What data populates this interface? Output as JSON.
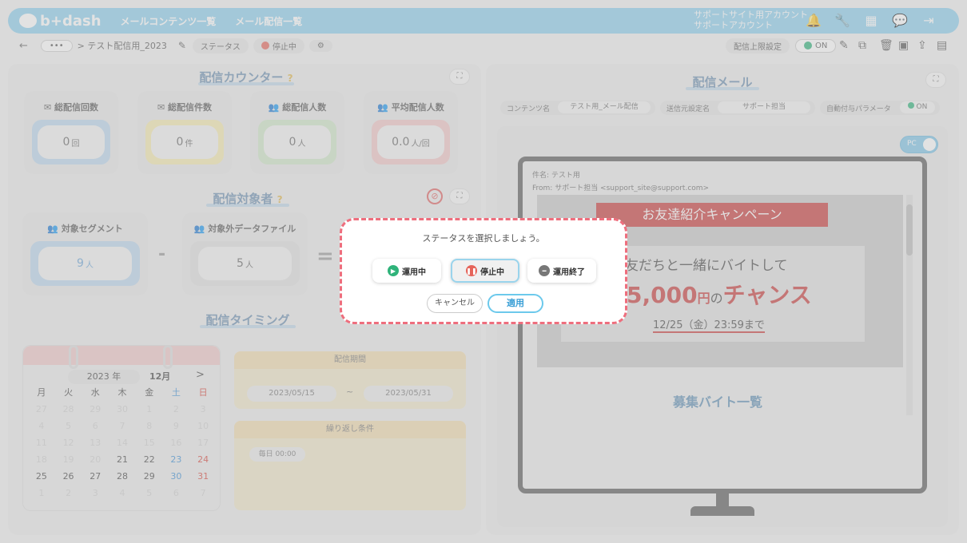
{
  "header": {
    "logo": "b+dash",
    "nav": [
      "メールコンテンツ一覧",
      "メール配信一覧"
    ],
    "account_line1": "サポートサイト用アカウント",
    "account_line2": "サポートアカウント",
    "icons": [
      "bell-icon",
      "wrench-icon",
      "grid-icon",
      "chat-icon",
      "logout-icon"
    ]
  },
  "toolbar": {
    "back": "←",
    "more": "•••",
    "breadcrumb": "> テスト配信用_2023",
    "status_label": "ステータス",
    "status_value": "停止中",
    "limit_label": "配信上限設定",
    "limit_toggle": "ON"
  },
  "counter": {
    "title": "配信カウンター",
    "cards": [
      {
        "label": "総配信回数",
        "value": "0",
        "unit": "回",
        "color": "#bcd7ee"
      },
      {
        "label": "総配信件数",
        "value": "0",
        "unit": "件",
        "color": "#f6ecb0"
      },
      {
        "label": "総配信人数",
        "value": "0",
        "unit": "人",
        "color": "#cfe7c8"
      },
      {
        "label": "平均配信人数",
        "value": "0.0",
        "unit": "人/回",
        "color": "#f3c7c7"
      }
    ]
  },
  "target": {
    "title": "配信対象者",
    "segment_label": "対象セグメント",
    "segment_value": "9",
    "segment_unit": "人",
    "exclude_label": "対象外データファイル",
    "exclude_value": "5",
    "exclude_unit": "人",
    "minus": "-",
    "equals": "="
  },
  "timing": {
    "title": "配信タイミング",
    "calendar": {
      "year": "2023 年",
      "month": "12月",
      "next": ">",
      "weekdays": [
        "月",
        "火",
        "水",
        "木",
        "金",
        "土",
        "日"
      ],
      "rows": [
        [
          "27",
          "28",
          "29",
          "30",
          "1",
          "2",
          "3"
        ],
        [
          "4",
          "5",
          "6",
          "7",
          "8",
          "9",
          "10"
        ],
        [
          "11",
          "12",
          "13",
          "14",
          "15",
          "16",
          "17"
        ],
        [
          "18",
          "19",
          "20",
          "21",
          "22",
          "23",
          "24"
        ],
        [
          "25",
          "26",
          "27",
          "28",
          "29",
          "30",
          "31"
        ],
        [
          "1",
          "2",
          "3",
          "4",
          "5",
          "6",
          "7"
        ]
      ]
    },
    "period_label": "配信期間",
    "start": "2023/05/15",
    "tilde": "~",
    "end": "2023/05/31",
    "repeat_label": "繰り返し条件",
    "repeat_value": "毎日 00:00"
  },
  "mail": {
    "title": "配信メール",
    "fields": [
      {
        "label": "コンテンツ名",
        "value": "テスト用_メール配信"
      },
      {
        "label": "送信元設定名",
        "value": "サポート担当"
      },
      {
        "label": "自動付与パラメータ",
        "value": "ON"
      }
    ],
    "device": "PC",
    "subject": "件名: テスト用",
    "from": "From: サポート担当 <support_site@support.com>",
    "banner_title": "お友達紹介キャンペーン",
    "banner_line1": "友だちと一緒にバイトして",
    "banner_amount": "5,000",
    "banner_yen": "円",
    "banner_no": "の",
    "banner_chance": "チャンス",
    "banner_deadline": "12/25（金）23:59まで",
    "list_title": "募集バイト一覧"
  },
  "modal": {
    "prompt": "ステータスを選択しましょう。",
    "options": [
      {
        "label": "運用中",
        "color": "#2fb37a"
      },
      {
        "label": "停止中",
        "color": "#e5645a"
      },
      {
        "label": "運用終了",
        "color": "#777777"
      }
    ],
    "selected": "停止中",
    "cancel": "キャンセル",
    "apply": "適用"
  }
}
